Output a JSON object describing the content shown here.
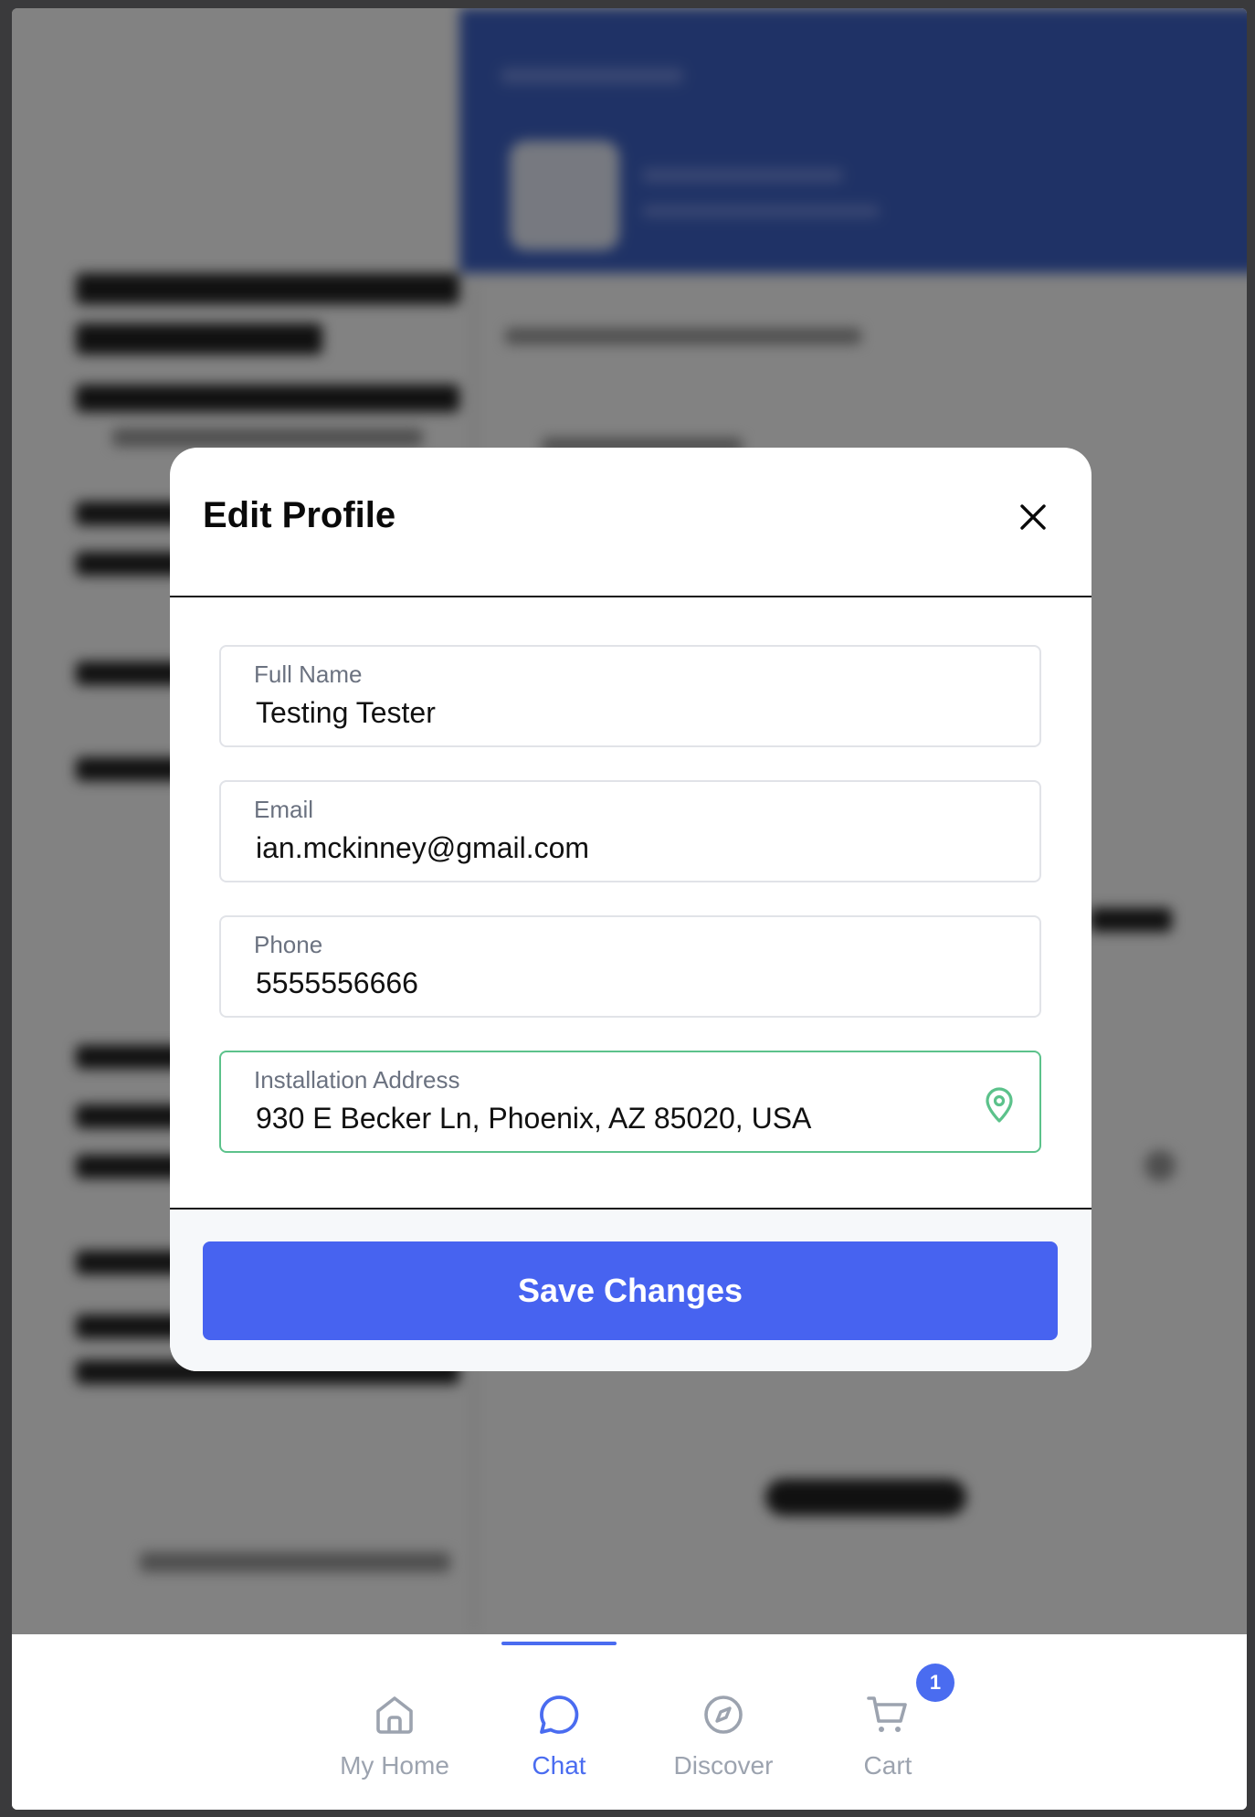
{
  "modal": {
    "title": "Edit Profile",
    "fields": [
      {
        "label": "Full Name",
        "value": "Testing Tester"
      },
      {
        "label": "Email",
        "value": "ian.mckinney@gmail.com"
      },
      {
        "label": "Phone",
        "value": "5555556666"
      },
      {
        "label": "Installation Address",
        "value": "930 E Becker Ln, Phoenix, AZ 85020, USA"
      }
    ],
    "save_label": "Save Changes"
  },
  "nav": {
    "items": [
      {
        "label": "My Home",
        "icon": "home-icon"
      },
      {
        "label": "Chat",
        "icon": "chat-icon",
        "active": true
      },
      {
        "label": "Discover",
        "icon": "compass-icon"
      },
      {
        "label": "Cart",
        "icon": "cart-icon",
        "badge": "1"
      }
    ]
  },
  "colors": {
    "accent": "#4763f0",
    "active_field_border": "#5cc28b",
    "scrim": "rgba(0,0,0,0.49)",
    "inactive_nav": "#9ca3af"
  }
}
